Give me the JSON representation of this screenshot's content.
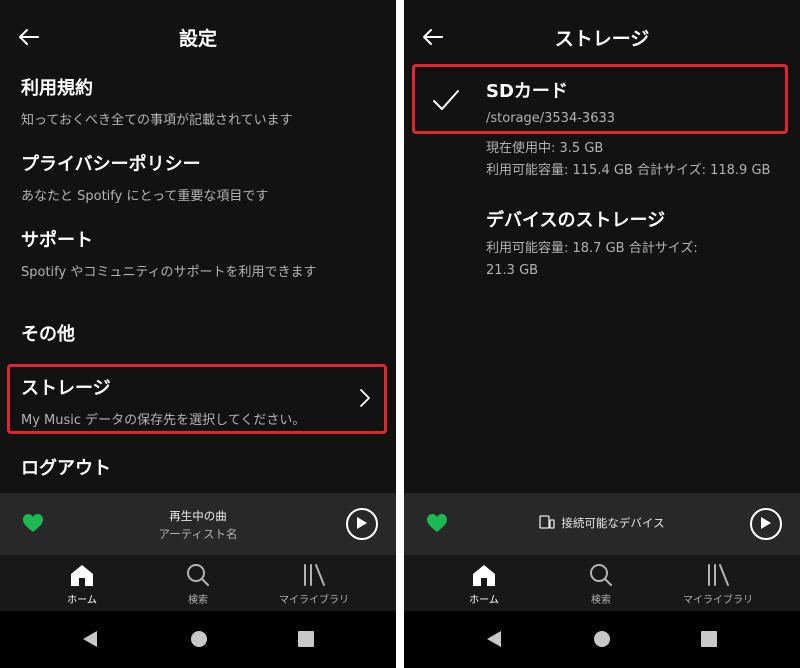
{
  "left": {
    "header": {
      "title": "設定"
    },
    "items": [
      {
        "title": "利用規約",
        "subtitle": "知っておくべき全ての事項が記載されています"
      },
      {
        "title": "プライバシーポリシー",
        "subtitle": "あなたと Spotify にとって重要な項目です"
      },
      {
        "title": "サポート",
        "subtitle": "Spotify やコミュニティのサポートを利用できます"
      }
    ],
    "section_other": "その他",
    "storage": {
      "title": "ストレージ",
      "subtitle": "My Music データの保存先を選択してください。"
    },
    "logout": "ログアウト",
    "player": {
      "track": "再生中の曲",
      "artist": "アーティスト名"
    }
  },
  "right": {
    "header": {
      "title": "ストレージ"
    },
    "sd": {
      "title": "SDカード",
      "path": "/storage/3534-3633"
    },
    "sd_usage": "現在使用中: 3.5 GB",
    "sd_capacity": "利用可能容量: 115.4 GB 合計サイズ: 118.9 GB",
    "device": {
      "title": "デバイスのストレージ",
      "capacity_line1": "利用可能容量: 18.7 GB 合計サイズ:",
      "capacity_line2": "21.3 GB"
    },
    "player": {
      "connect_label": "接続可能なデバイス"
    }
  },
  "tabs": {
    "home": "ホーム",
    "search": "検索",
    "library": "マイライブラリ"
  },
  "colors": {
    "background": "#121212",
    "accent_green": "#1db954",
    "highlight_red": "#e0262f"
  }
}
